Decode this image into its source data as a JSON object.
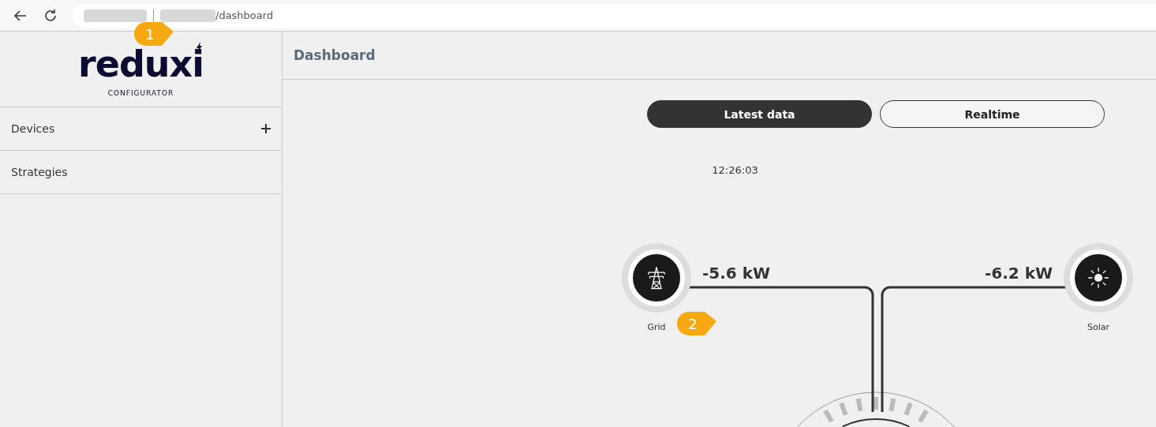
{
  "browser": {
    "url": "/dashboard"
  },
  "callouts": [
    "1",
    "2"
  ],
  "logo": {
    "name": "reduxi",
    "subtitle": "CONFIGURATOR"
  },
  "sidebar": {
    "items": [
      {
        "label": "Devices",
        "addable": true
      },
      {
        "label": "Strategies",
        "addable": false
      }
    ]
  },
  "page": {
    "title": "Dashboard"
  },
  "view_tabs": [
    {
      "label": "Latest data",
      "selected": true
    },
    {
      "label": "Realtime",
      "selected": false
    }
  ],
  "timestamp": "12:26:03",
  "flow": {
    "nodes": [
      {
        "kind": "grid",
        "label": "Grid",
        "value": "-5.6 kW"
      },
      {
        "kind": "solar",
        "label": "Solar",
        "value": "-6.2 kW"
      }
    ]
  }
}
